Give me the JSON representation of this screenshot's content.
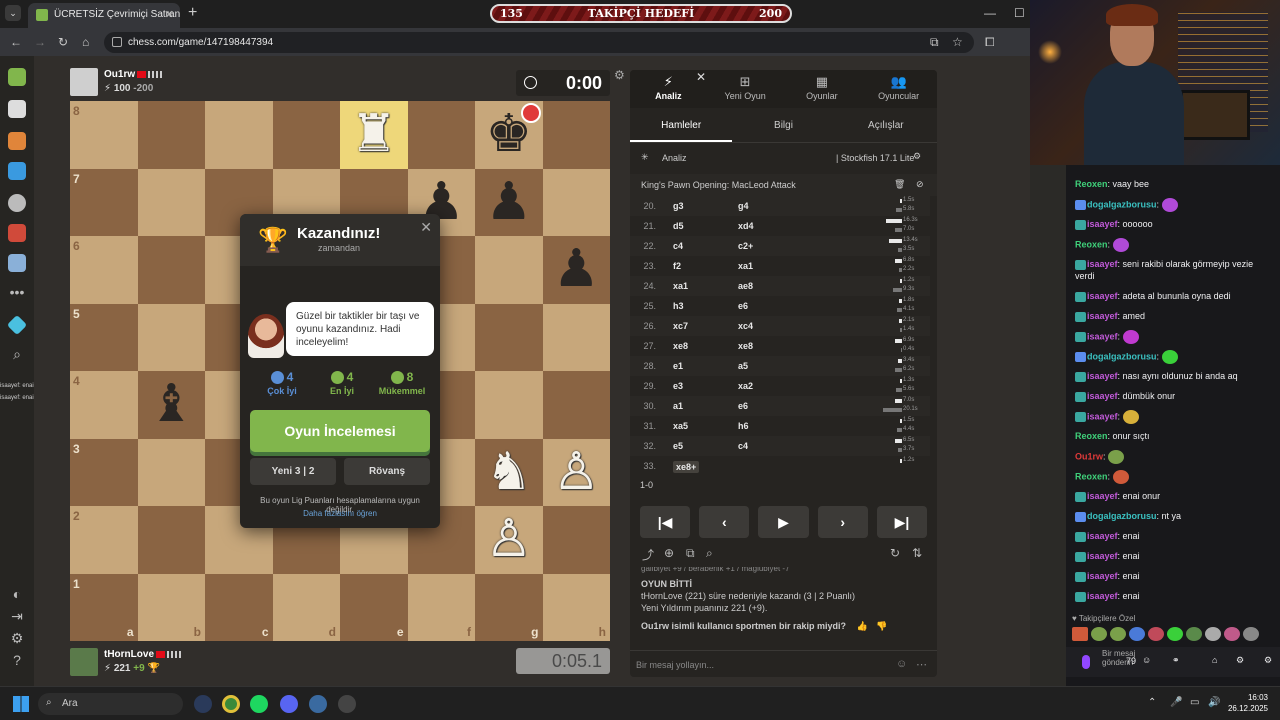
{
  "browser": {
    "tab_title": "ÜCRETSİZ Çevrimiçi Satranç Oyna",
    "url": "chess.com/game/147198447394"
  },
  "stream_goal": {
    "current": "135",
    "label": "TAKİPÇİ HEDEFİ",
    "target": "200"
  },
  "top_player": {
    "name": "Ou1rw",
    "rating": "100",
    "delta": "-200",
    "clock": "0:00"
  },
  "bottom_player": {
    "name": "tHornLove",
    "rating": "221",
    "delta": "+9",
    "clock": "0:05.1"
  },
  "board": {
    "ranks": [
      "8",
      "7",
      "6",
      "5",
      "4",
      "3",
      "2",
      "1"
    ],
    "files": [
      "a",
      "b",
      "c",
      "d",
      "e",
      "f",
      "g",
      "h"
    ]
  },
  "modal": {
    "title": "Kazandınız!",
    "subtitle": "zamandan",
    "coach_message": "Güzel bir taktikler bir taşı ve oyunu kazandınız. Hadi inceleyelim!",
    "stats": [
      {
        "value": "4",
        "label": "Çok İyi",
        "color": "#5a8fd6"
      },
      {
        "value": "4",
        "label": "En İyi",
        "color": "#81b64c"
      },
      {
        "value": "8",
        "label": "Mükemmel",
        "color": "#81b64c"
      }
    ],
    "review_button": "Oyun İncelemesi",
    "new_game_button": "Yeni 3 | 2",
    "rematch_button": "Rövanş",
    "note": "Bu oyun Lig Puanları hesaplamalarına uygun değildir.",
    "link": "Daha fazlasını öğren"
  },
  "panel": {
    "tabs": [
      "Analiz",
      "Yeni Oyun",
      "Oyunlar",
      "Oyuncular"
    ],
    "subtabs": [
      "Hamleler",
      "Bilgi",
      "Açılışlar"
    ],
    "engine_label": "Analiz",
    "engine_name": "Stockfish 17.1 Lite",
    "opening": "King's Pawn Opening: MacLeod Attack",
    "moves": [
      {
        "n": "20.",
        "w": "g3",
        "b": "g4",
        "t1": "1.5s",
        "t2": "5.8s"
      },
      {
        "n": "21.",
        "w": "d5",
        "b": "xd4",
        "t1": "16.3s",
        "t2": "7.0s"
      },
      {
        "n": "22.",
        "w": "c4",
        "b": "c2+",
        "t1": "13.4s",
        "t2": "3.5s"
      },
      {
        "n": "23.",
        "w": "f2",
        "b": "xa1",
        "t1": "6.8s",
        "t2": "2.2s"
      },
      {
        "n": "24.",
        "w": "xa1",
        "b": "ae8",
        "t1": "1.2s",
        "t2": "9.3s"
      },
      {
        "n": "25.",
        "w": "h3",
        "b": "e6",
        "t1": "1.8s",
        "t2": "4.1s"
      },
      {
        "n": "26.",
        "w": "xc7",
        "b": "xc4",
        "t1": "2.1s",
        "t2": "1.4s"
      },
      {
        "n": "27.",
        "w": "xe8",
        "b": "xe8",
        "t1": "6.9s",
        "t2": "0.4s"
      },
      {
        "n": "28.",
        "w": "e1",
        "b": "a5",
        "t1": "3.4s",
        "t2": "6.2s"
      },
      {
        "n": "29.",
        "w": "e3",
        "b": "xa2",
        "t1": "1.3s",
        "t2": "5.6s"
      },
      {
        "n": "30.",
        "w": "a1",
        "b": "e6",
        "t1": "7.0s",
        "t2": "20.1s"
      },
      {
        "n": "31.",
        "w": "xa5",
        "b": "h6",
        "t1": "1.5s",
        "t2": "4.4s"
      },
      {
        "n": "32.",
        "w": "e5",
        "b": "c4",
        "t1": "6.5s",
        "t2": "3.7s"
      },
      {
        "n": "33.",
        "w": "xe8+",
        "b": "",
        "t1": "1.2s",
        "t2": ""
      }
    ],
    "result": "1-0",
    "log_cut": "galibiyet +9 / beraberlik +1 / mağlubiyet -7",
    "log_title": "OYUN BİTTİ",
    "log_line1": "tHornLove (221) süre nedeniyle kazandı (3 | 2 Puanlı)",
    "log_line2": "Yeni Yıldırım puanınız 221 (+9).",
    "log_question": "Ou1rw isimli kullanıcı sportmen bir rakip miydi?",
    "chat_placeholder": "Bir mesaj yollayın..."
  },
  "stream_chat": [
    {
      "user": "Reoxen",
      "msg": "vaay bee",
      "color": "#3fd07a",
      "badge": ""
    },
    {
      "user": "dogalgazborusu",
      "msg": "",
      "color": "#3ac0c0",
      "badge": "p",
      "emote": "#b04ad8"
    },
    {
      "user": "isaayef",
      "msg": "oooooo",
      "color": "#c05ad8",
      "badge": "t"
    },
    {
      "user": "Reoxen",
      "msg": "",
      "color": "#3fd07a",
      "badge": "",
      "emote": "#b04ad8"
    },
    {
      "user": "isaayef",
      "msg": "seni rakibi olarak görmeyip vezie verdi",
      "color": "#c05ad8",
      "badge": "t"
    },
    {
      "user": "isaayef",
      "msg": "adeta al bununla oyna dedi",
      "color": "#c05ad8",
      "badge": "t"
    },
    {
      "user": "isaayef",
      "msg": "amed",
      "color": "#c05ad8",
      "badge": "t"
    },
    {
      "user": "isaayef",
      "msg": "",
      "color": "#c05ad8",
      "badge": "t",
      "emote": "#c03ad0"
    },
    {
      "user": "dogalgazborusu",
      "msg": "",
      "color": "#3ac0c0",
      "badge": "p",
      "emote": "#3ad03a"
    },
    {
      "user": "isaayef",
      "msg": "nası aynı oldunuz bi anda aq",
      "color": "#c05ad8",
      "badge": "t"
    },
    {
      "user": "isaayef",
      "msg": "dümbük onur",
      "color": "#c05ad8",
      "badge": "t"
    },
    {
      "user": "isaayef",
      "msg": "",
      "color": "#c05ad8",
      "badge": "t",
      "emote": "#d8b03a"
    },
    {
      "user": "Reoxen",
      "msg": "onur sıçtı",
      "color": "#3fd07a",
      "badge": ""
    },
    {
      "user": "Ou1rw",
      "msg": "",
      "color": "#e03a3a",
      "badge": "",
      "emote": "#7aa04a"
    },
    {
      "user": "Reoxen",
      "msg": "",
      "color": "#3fd07a",
      "badge": "",
      "emote": "#d05a3a"
    },
    {
      "user": "isaayef",
      "msg": "enai onur",
      "color": "#c05ad8",
      "badge": "t"
    },
    {
      "user": "dogalgazborusu",
      "msg": "nt ya",
      "color": "#3ac0c0",
      "badge": "p"
    },
    {
      "user": "isaayef",
      "msg": "enai",
      "color": "#c05ad8",
      "badge": "t"
    },
    {
      "user": "isaayef",
      "msg": "enai",
      "color": "#c05ad8",
      "badge": "t"
    },
    {
      "user": "isaayef",
      "msg": "enai",
      "color": "#c05ad8",
      "badge": "t"
    },
    {
      "user": "isaayef",
      "msg": "enai",
      "color": "#c05ad8",
      "badge": "t"
    }
  ],
  "followers_label": "Takipçilere Özel",
  "chat_send": "Bir mesaj gönderin",
  "chat_count": "79",
  "side_overlay": [
    "isaayef: enai",
    "isaayef: enai"
  ],
  "taskbar": {
    "search": "Ara",
    "time": "16:03",
    "date": "26.12.2025"
  }
}
